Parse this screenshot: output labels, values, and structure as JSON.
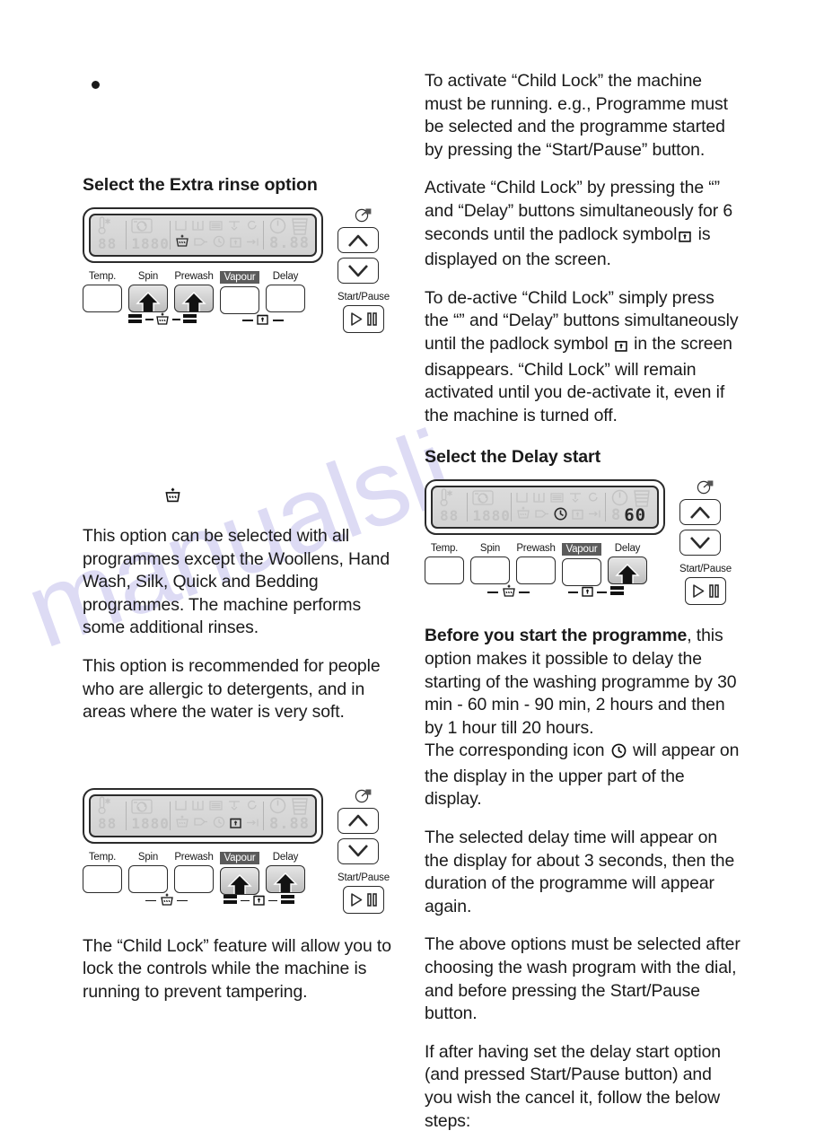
{
  "watermark_text": "manualsli",
  "left_column": {
    "bullet_marker": "•",
    "section_heading": "Select the Extra rinse option",
    "panel_a": {
      "buttons": [
        "Temp.",
        "Spin",
        "Prewash",
        "Vapour",
        "Delay"
      ],
      "start_pause_label": "Start/Pause",
      "pressed": [
        "Spin",
        "Prewash"
      ],
      "display_value": "8.88",
      "temp_value": "88",
      "spin_value": "1880",
      "active_icons": [
        "extra-rinse"
      ]
    },
    "standalone_icon": "extra-rinse-icon",
    "paragraphs": [
      "This option can be selected with all programmes except the Woollens, Hand Wash, Silk, Quick and Bedding programmes. The machine performs some additional rinses.",
      "This option is recommended for people who are allergic to detergents, and in areas where the water is very soft."
    ],
    "panel_b": {
      "buttons": [
        "Temp.",
        "Spin",
        "Prewash",
        "Vapour",
        "Delay"
      ],
      "start_pause_label": "Start/Pause",
      "pressed": [
        "Vapour",
        "Delay"
      ],
      "display_value": "8.88",
      "temp_value": "88",
      "spin_value": "1880",
      "active_icons": [
        "child-lock-padlock"
      ]
    },
    "closing_paragraph": "The “Child Lock” feature will allow you to lock the controls while the machine is running to prevent tampering."
  },
  "right_column": {
    "paragraphs_top": [
      "To activate “Child Lock” the machine must be running. e.g., Programme must be selected and the programme started by pressing the “Start/Pause” button.",
      "Activate “Child Lock” by pressing the “” and “Delay” buttons simultaneously for 6 seconds until the padlock symbol",
      "is displayed on the screen.",
      "To de-active “Child Lock” simply press the “” and “Delay” buttons simultaneously until the padlock symbol",
      "in the screen disappears. “Child Lock” will remain activated until you de-activate it, even if the machine is turned off."
    ],
    "section_heading": "Select the Delay start",
    "panel_c": {
      "buttons": [
        "Temp.",
        "Spin",
        "Prewash",
        "Vapour",
        "Delay"
      ],
      "start_pause_label": "Start/Pause",
      "pressed": [
        "Delay"
      ],
      "display_value": "60",
      "temp_value": "88",
      "spin_value": "1880",
      "active_icons": [
        "delay-clock",
        "60"
      ]
    },
    "para_bold_lead": "Before you start the programme",
    "para_after_bold": ", this option makes it possible to delay the starting of the washing programme by 30 min - 60 min - 90 min, 2 hours and then by 1 hour till 20 hours.",
    "para_icon_line_before": "The corresponding icon",
    "para_icon_line_after": "will appear on the display in the upper part of the display.",
    "paragraphs_bottom": [
      "The selected delay time will appear on the display for about 3 seconds, then the duration of the programme will appear again.",
      "The above options must be selected after choosing the wash program with the dial, and before pressing the Start/Pause button.",
      "If after having set the delay start option (and pressed Start/Pause button) and you wish the cancel it, follow the below steps:"
    ]
  },
  "colors": {
    "ink": "#1a1a1a",
    "lcd_off": "#c3c3c3",
    "lcd_on": "#2a2a2a",
    "watermark": "#c9c6ee"
  }
}
